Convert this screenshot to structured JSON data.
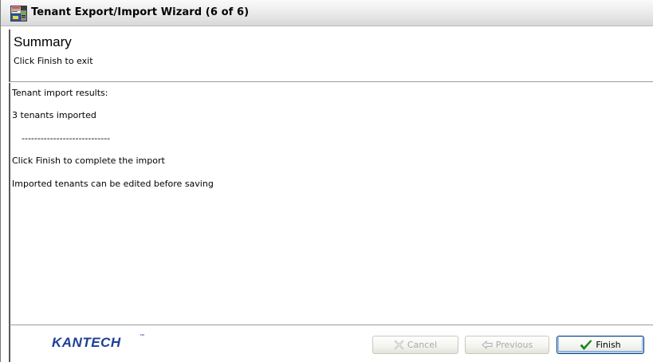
{
  "window": {
    "title": "Tenant Export/Import Wizard (6 of 6)",
    "icon": "app-icon"
  },
  "header": {
    "title": "Summary",
    "subtitle": "Click Finish to exit"
  },
  "results": {
    "lines": [
      "Tenant import results:",
      "3 tenants imported",
      "----------------------------",
      "Click Finish to complete the import",
      "Imported tenants can be edited before saving"
    ]
  },
  "footer": {
    "logo": "KANTECH",
    "logo_tm": "™",
    "buttons": {
      "cancel": {
        "label": "Cancel",
        "icon": "x-icon",
        "enabled": false
      },
      "previous": {
        "label": "Previous",
        "icon": "arrow-left-icon",
        "enabled": false
      },
      "finish": {
        "label": "Finish",
        "icon": "checkmark-icon",
        "enabled": true
      }
    }
  },
  "colors": {
    "logo": "#1f3f95",
    "check": "#1a9a1a",
    "disabled_text": "#a9a9a9"
  }
}
